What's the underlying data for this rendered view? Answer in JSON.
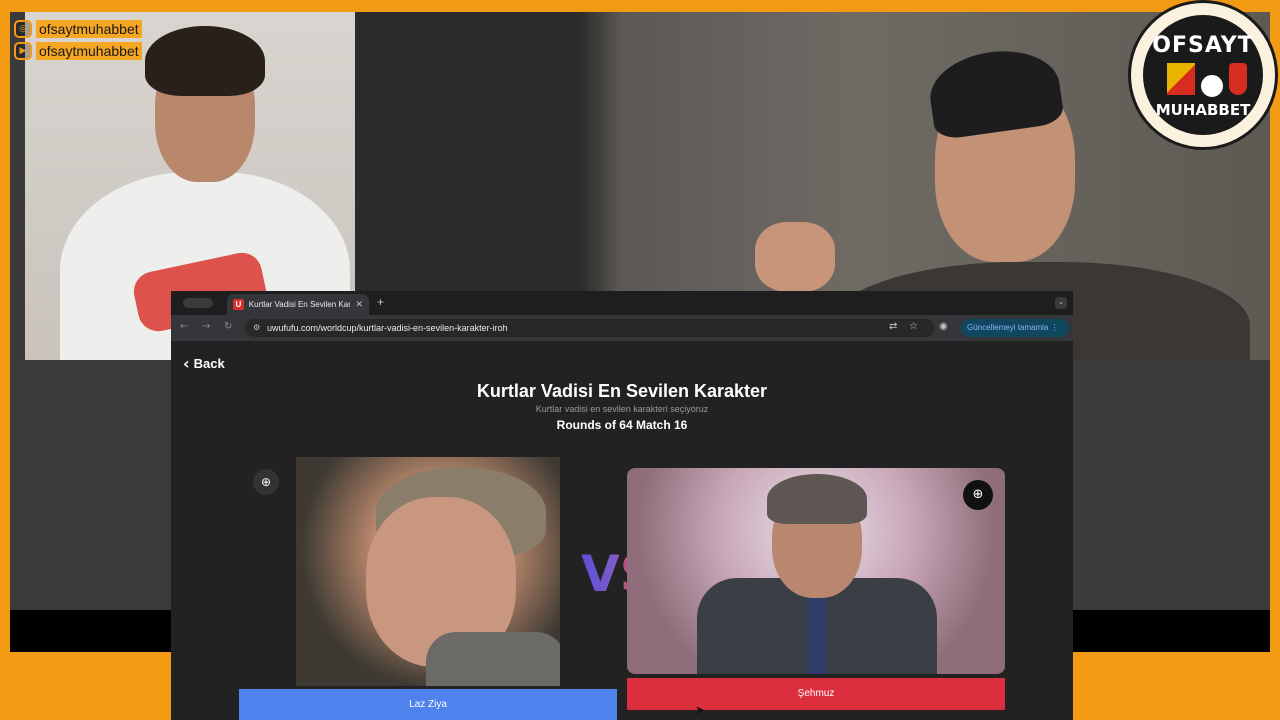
{
  "overlay": {
    "instagram_handle": "ofsaytmuhabbet",
    "youtube_handle": "ofsaytmuhabbet",
    "logo_top": "OFSAYT",
    "logo_bottom": "MUHABBET"
  },
  "browser": {
    "tab_title": "Kurtlar Vadisi En Sevilen Kara",
    "tab_favicon": "U",
    "new_tab": "+",
    "url": "uwufufu.com/worldcup/kurtlar-vadisi-en-sevilen-karakter-iroh",
    "update_button": "Güncellemeyi tamamla"
  },
  "page": {
    "back_label": "Back",
    "title": "Kurtlar Vadisi En Sevilen Karakter",
    "subtitle": "Kurtlar vadisi en sevilen karakteri seçiyoruz",
    "round_text": "Rounds of 64 Match 16",
    "vs_text": "VS",
    "left_choice": "Laz Ziya",
    "right_choice": "Şehmuz"
  },
  "colors": {
    "frame_orange": "#f39a14",
    "left_button": "#4f82ec",
    "right_button": "#dc2f3d"
  }
}
